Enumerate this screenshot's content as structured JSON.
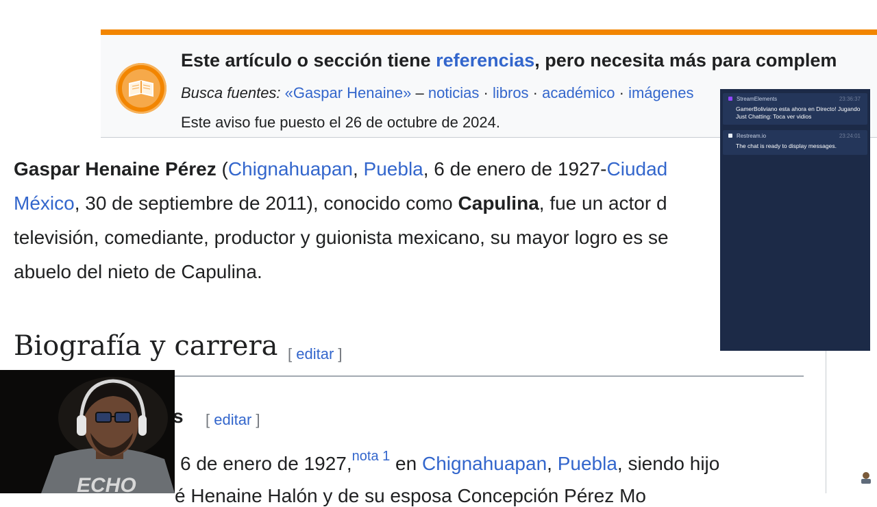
{
  "notice": {
    "line1_pre": "Este artículo o sección tiene ",
    "line1_link": "referencias",
    "line1_post": ", pero necesita más para complem",
    "search_label": "Busca fuentes:",
    "search_query": "«Gaspar Henaine»",
    "dash": " – ",
    "links": [
      "noticias",
      "libros",
      "académico",
      "imágenes"
    ],
    "separator": " · ",
    "date_text": "Este aviso fue puesto el 26 de octubre de 2024."
  },
  "article": {
    "name_bold": "Gaspar Henaine Pérez",
    "open_paren": " (",
    "place1": "Chignahuapan",
    "comma": ", ",
    "place2": "Puebla",
    "birth": ", 6 de enero de 1927-",
    "place3": "Ciudad",
    "place3b": "México",
    "death": ", 30 de septiembre de 2011), conocido como ",
    "nickname": "Capulina",
    "rest1": ", fue un actor d",
    "line3": "televisión, comediante, productor y guionista mexicano, su mayor logro es se",
    "line4": "abuelo del nieto de Capulina."
  },
  "section": {
    "heading": "Biografía y carrera",
    "edit_open": "[ ",
    "edit_label": "editar",
    "edit_close": " ]",
    "sub_heading_tail": "s",
    "bio_line_pre": "6 de enero de 1927,",
    "bio_note": "nota 1",
    "bio_line_mid": " en ",
    "bio_place1": "Chignahuapan",
    "bio_place2": "Puebla",
    "bio_line_post": ", siendo hijo",
    "bio_line2": "é Henaine Halón y de su esposa Concepción Pérez Mo"
  },
  "chat": {
    "messages": [
      {
        "source": "StreamElements",
        "time": "23:36:37",
        "text": "GamerBoliviano esta ahora en Directo! Jugando Just Chatting: Toca ver vidios",
        "color": "#9146ff"
      },
      {
        "source": "Restream.io",
        "time": "23:24:01",
        "text": "The chat is ready to display messages.",
        "color": "#e8eef7"
      }
    ]
  },
  "webcam": {
    "shirt_text": "ECHO"
  },
  "colors": {
    "notice_border": "#f28500",
    "link": "#3366cc",
    "chat_bg": "#1c2a47"
  }
}
